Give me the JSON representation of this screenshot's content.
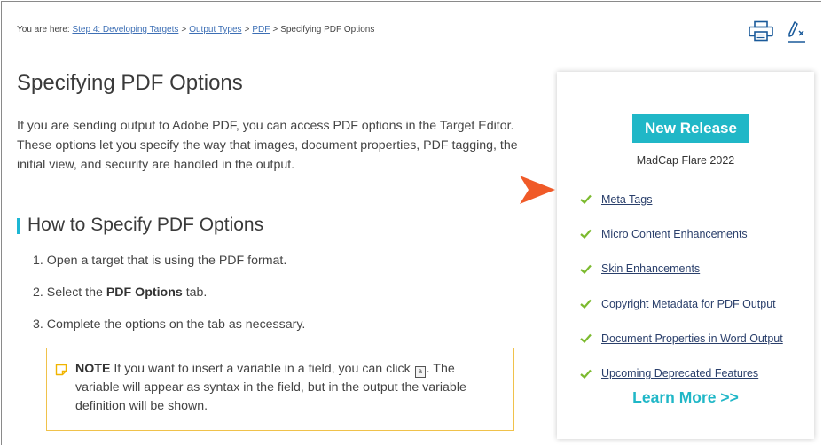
{
  "breadcrumb": {
    "prefix": "You are here: ",
    "crumbs": [
      "Step 4: Developing Targets",
      "Output Types",
      "PDF"
    ],
    "separator": ">",
    "current": "Specifying PDF Options"
  },
  "toolbar": {
    "print_icon": "printer-icon",
    "highlight_icon": "remove-highlight-icon"
  },
  "page": {
    "title": "Specifying PDF Options",
    "intro": "If you are sending output to Adobe PDF, you can access PDF options in the Target Editor. These options let you specify the way that images, document properties, PDF tagging, the initial view, and security are handled in the output.",
    "section_heading": "How to Specify PDF Options",
    "steps": [
      {
        "num": "1.",
        "text": "Open a target that is using the PDF format."
      },
      {
        "num": "2.",
        "before": "Select the ",
        "bold": "PDF Options",
        "after": " tab."
      },
      {
        "num": "3.",
        "text": "Complete the options on the tab as necessary."
      }
    ],
    "note": {
      "label": "NOTE",
      "before": " If you want to insert a variable in a field, you can click ",
      "icon_glyph": "a",
      "after": ". The variable will appear as syntax in the field, but in the output the variable definition will be shown."
    }
  },
  "promo": {
    "badge": "New Release",
    "product": "MadCap Flare 2022",
    "features": [
      "Meta Tags",
      "Micro Content Enhancements",
      "Skin Enhancements",
      "Copyright Metadata for PDF Output",
      "Document Properties in Word Output",
      "Upcoming Deprecated Features"
    ],
    "learn_more": "Learn More >>"
  },
  "colors": {
    "accent": "#20b7c7",
    "arrow": "#f05a28",
    "check": "#7cba2f",
    "note_border": "#f0c24b",
    "link": "#3d6fb5"
  }
}
